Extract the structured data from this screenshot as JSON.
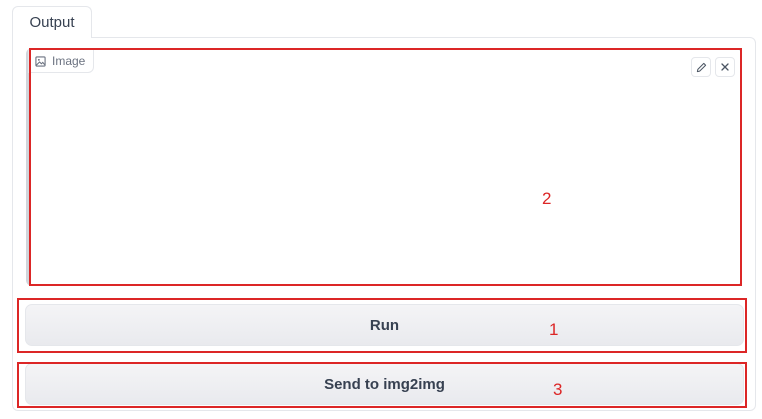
{
  "tabs": [
    {
      "label": "Output",
      "active": true
    }
  ],
  "image_component": {
    "label": "Image",
    "icon": "image-icon",
    "actions": [
      {
        "icon": "pencil-icon"
      },
      {
        "icon": "close-icon"
      }
    ]
  },
  "buttons": {
    "run_label": "Run",
    "send_label": "Send to img2img"
  },
  "annotations": {
    "image_number": "2",
    "run_number": "1",
    "send_number": "3",
    "color": "#dc2626"
  }
}
